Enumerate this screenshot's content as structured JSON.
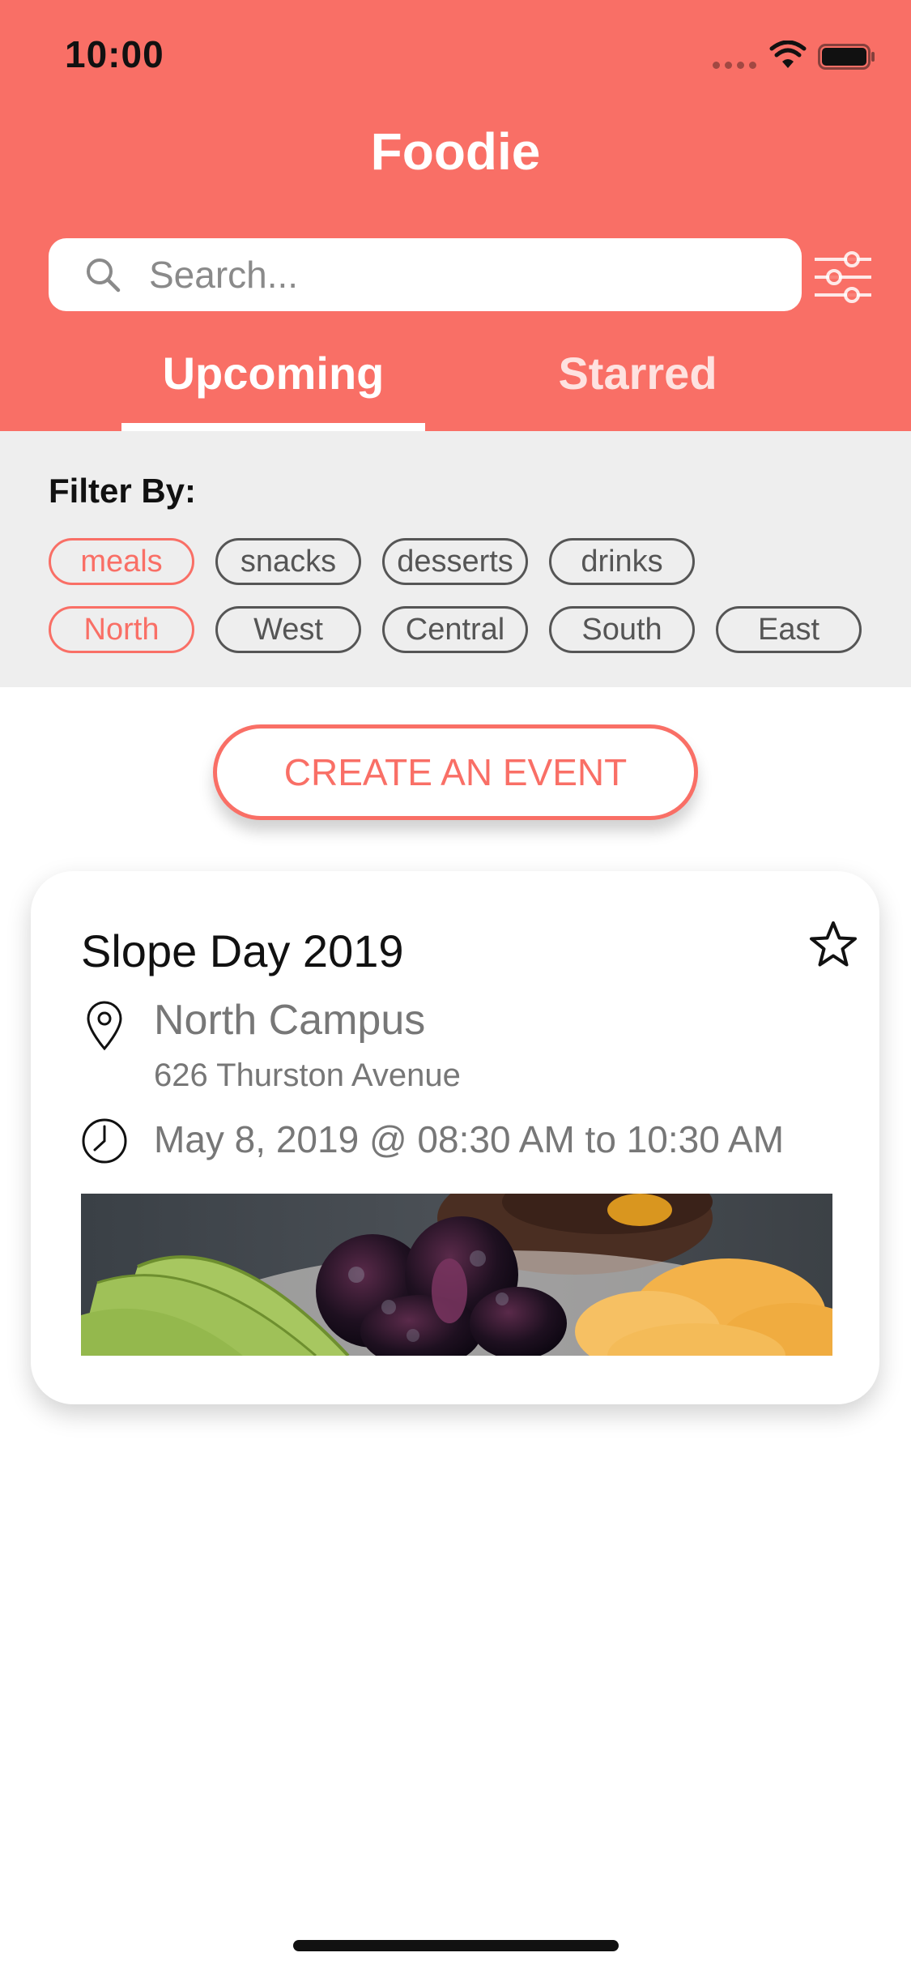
{
  "status_bar": {
    "time": "10:00"
  },
  "header": {
    "title": "Foodie",
    "background_color": "#F96F66"
  },
  "search": {
    "placeholder": "Search...",
    "value": ""
  },
  "tabs": [
    {
      "label": "Upcoming",
      "selected": true
    },
    {
      "label": "Starred",
      "selected": false
    }
  ],
  "filters": {
    "label": "Filter By:",
    "categories": [
      {
        "label": "meals",
        "active": true
      },
      {
        "label": "snacks",
        "active": false
      },
      {
        "label": "desserts",
        "active": false
      },
      {
        "label": "drinks",
        "active": false
      }
    ],
    "regions": [
      {
        "label": "North",
        "active": true
      },
      {
        "label": "West",
        "active": false
      },
      {
        "label": "Central",
        "active": false
      },
      {
        "label": "South",
        "active": false
      },
      {
        "label": "East",
        "active": false
      }
    ]
  },
  "create_event": {
    "label": "CREATE AN EVENT"
  },
  "events": [
    {
      "title": "Slope Day 2019",
      "location": "North Campus",
      "address": "626 Thurston Avenue",
      "time": "May 8, 2019 @ 08:30 AM to 10:30 AM",
      "starred": false
    }
  ],
  "colors": {
    "accent": "#F96F66",
    "filter_background": "#EEEEEE",
    "secondary_text": "#777777"
  }
}
